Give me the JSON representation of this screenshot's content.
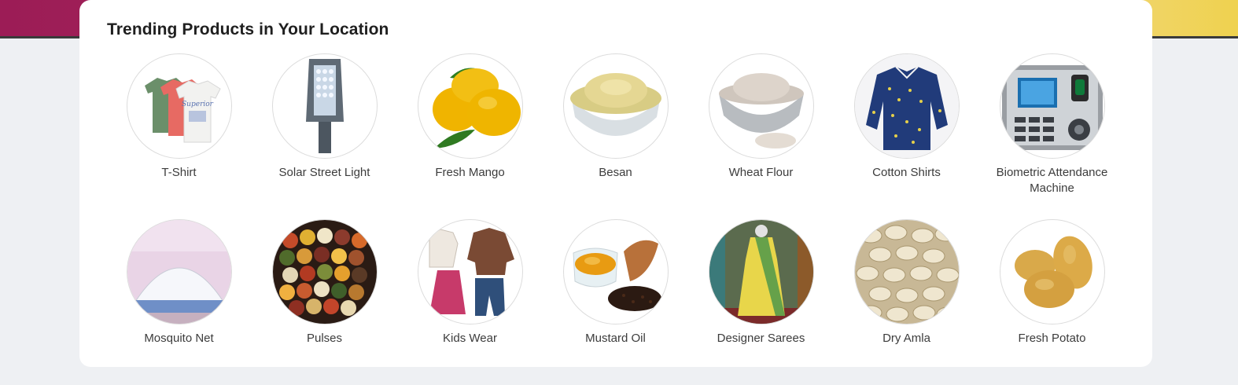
{
  "section": {
    "title": "Trending Products in Your Location"
  },
  "products": [
    {
      "label": "T-Shirt",
      "icon": "tshirt-icon"
    },
    {
      "label": "Solar Street Light",
      "icon": "street-light-icon"
    },
    {
      "label": "Fresh Mango",
      "icon": "mango-icon"
    },
    {
      "label": "Besan",
      "icon": "flour-bowl-icon"
    },
    {
      "label": "Wheat Flour",
      "icon": "flour-steel-bowl-icon"
    },
    {
      "label": "Cotton Shirts",
      "icon": "shirt-icon"
    },
    {
      "label": "Biometric Attendance Machine",
      "icon": "biometric-device-icon"
    },
    {
      "label": "Mosquito Net",
      "icon": "mosquito-net-icon"
    },
    {
      "label": "Pulses",
      "icon": "pulses-icon"
    },
    {
      "label": "Kids Wear",
      "icon": "kids-clothes-icon"
    },
    {
      "label": "Mustard Oil",
      "icon": "oil-bowl-icon"
    },
    {
      "label": "Designer Sarees",
      "icon": "saree-icon"
    },
    {
      "label": "Dry Amla",
      "icon": "dry-amla-icon"
    },
    {
      "label": "Fresh Potato",
      "icon": "potato-icon"
    }
  ]
}
